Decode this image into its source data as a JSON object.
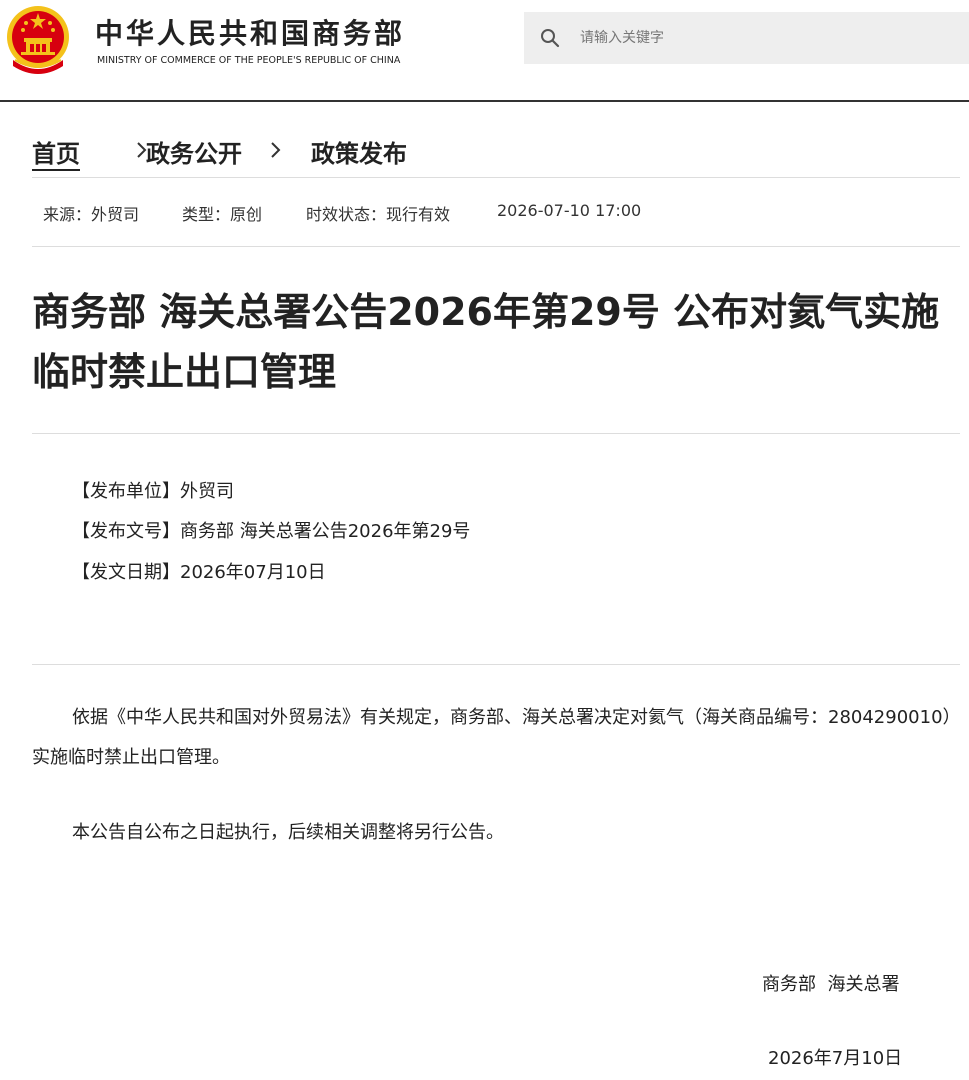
{
  "header": {
    "site_title_cn": "中华人民共和国商务部",
    "site_title_en": "MINISTRY OF COMMERCE OF THE PEOPLE'S REPUBLIC OF CHINA",
    "emblem_icon": "national-emblem-icon",
    "search": {
      "placeholder": "请输入关键字",
      "value": "",
      "icon": "search-icon"
    }
  },
  "breadcrumb": {
    "items": [
      "首页",
      "政务公开",
      "政策发布"
    ],
    "separator_icon": "chevron-right-icon"
  },
  "meta": {
    "source": "来源：外贸司",
    "type": "类型：原创",
    "status": "时效状态：现行有效",
    "datetime": "2026-07-10 17:00"
  },
  "article": {
    "title": "商务部 海关总署公告2026年第29号 公布对氦气实施临时禁止出口管理",
    "info": [
      "【发布单位】外贸司",
      "【发布文号】商务部 海关总署公告2026年第29号",
      "【发文日期】2026年07月10日"
    ],
    "paragraphs": [
      "依据《中华人民共和国对外贸易法》有关规定，商务部、海关总署决定对氦气（海关商品编号：2804290010）实施临时禁止出口管理。",
      "本公告自公布之日起执行，后续相关调整将另行公告。"
    ],
    "signature": "商务部  海关总署",
    "signature_date": "2026年7月10日"
  },
  "colors": {
    "text": "#222222",
    "search_bg": "#eeeeee",
    "emblem_red": "#d7000f",
    "emblem_gold": "#f4c21b",
    "divider": "#dddddd"
  }
}
